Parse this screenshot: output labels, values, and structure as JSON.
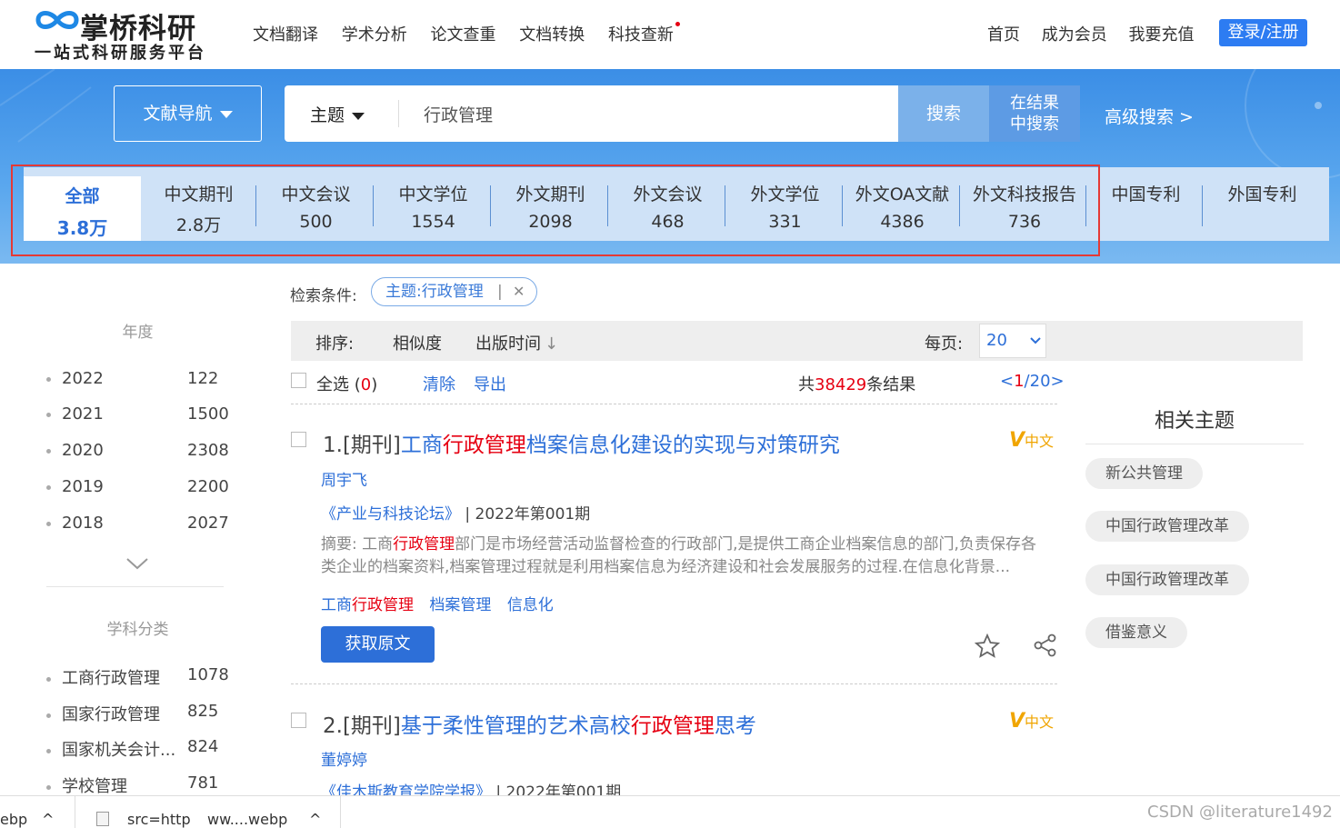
{
  "header": {
    "brand": "掌桥科研",
    "slogan": "一站式科研服务平台",
    "nav_left": [
      "文档翻译",
      "学术分析",
      "论文查重",
      "文档转换",
      "科技查新"
    ],
    "nav_right": [
      "首页",
      "成为会员",
      "我要充值"
    ],
    "login_label": "登录/注册"
  },
  "search": {
    "nav_dropdown": "文献导航",
    "field": "主题",
    "query": "行政管理",
    "search_label": "搜索",
    "result_search_line1": "在结果",
    "result_search_line2": "中搜索",
    "advanced_label": "高级搜索 >"
  },
  "tabs": [
    {
      "name": "全部",
      "count": "3.8万",
      "active": true
    },
    {
      "name": "中文期刊",
      "count": "2.8万"
    },
    {
      "name": "中文会议",
      "count": "500"
    },
    {
      "name": "中文学位",
      "count": "1554"
    },
    {
      "name": "外文期刊",
      "count": "2098"
    },
    {
      "name": "外文会议",
      "count": "468"
    },
    {
      "name": "外文学位",
      "count": "331"
    },
    {
      "name": "外文OA文献",
      "count": "4386"
    },
    {
      "name": "外文科技报告",
      "count": "736"
    },
    {
      "name": "中国专利",
      "count": ""
    },
    {
      "name": "外国专利",
      "count": ""
    }
  ],
  "sidebar": {
    "year_title": "年度",
    "years": [
      {
        "label": "2022",
        "count": "122"
      },
      {
        "label": "2021",
        "count": "1500"
      },
      {
        "label": "2020",
        "count": "2308"
      },
      {
        "label": "2019",
        "count": "2200"
      },
      {
        "label": "2018",
        "count": "2027"
      }
    ],
    "subject_title": "学科分类",
    "subjects": [
      {
        "label": "工商行政管理",
        "count": "1078"
      },
      {
        "label": "国家行政管理",
        "count": "825"
      },
      {
        "label": "国家机关会计...",
        "count": "824"
      },
      {
        "label": "学校管理",
        "count": "781"
      }
    ]
  },
  "conditions": {
    "label": "检索条件:",
    "tag": "主题:行政管理"
  },
  "sort": {
    "label": "排序:",
    "relevance": "相似度",
    "pubtime": "出版时间",
    "per_page_label": "每页:",
    "per_page_value": "20"
  },
  "select": {
    "all_label": "全选",
    "count_open": "(",
    "count": "0",
    "count_close": ")",
    "clear": "清除",
    "export": "导出",
    "total_prefix": "共",
    "total": "38429",
    "total_suffix": "条结果",
    "pager_open": "<",
    "pager_cur": "1",
    "pager_rest": "/20>"
  },
  "results": [
    {
      "prefix": "1.[期刊]",
      "title_parts": [
        "工商",
        "行政管理",
        "档案信息化建设的实现与对策研究"
      ],
      "badge_v": "V",
      "badge_lang": "中文",
      "author": "周宇飞",
      "journal": "《产业与科技论坛》",
      "issue": "| 2022年第001期",
      "abstract_parts": [
        "摘要: 工商",
        "行政管理",
        "部门是市场经营活动监督检查的行政部门,是提供工商企业档案信息的部门,负责保存各类企业的档案资料,档案管理过程就是利用档案信息为经济建设和社会发展服务的过程.在信息化背景..."
      ],
      "keywords": [
        [
          "工商",
          "行政管理"
        ],
        [
          "档案管理",
          ""
        ],
        [
          "信息化",
          ""
        ]
      ],
      "get_label": "获取原文"
    },
    {
      "prefix": "2.[期刊]",
      "title_parts": [
        "基于柔性管理的艺术高校",
        "行政管理",
        "思考"
      ],
      "badge_v": "V",
      "badge_lang": "中文",
      "author": "董婷婷",
      "journal": "《佳木斯教育学院学报》",
      "issue": "| 2022年第001期"
    }
  ],
  "related": {
    "title": "相关主题",
    "topics": [
      "新公共管理",
      "中国行政管理改革",
      "中国行政管理改革",
      "借鉴意义"
    ]
  },
  "download_bar": {
    "item1": "ebp",
    "item2a": "src=http",
    "item2b": "ww....webp"
  },
  "watermark": "CSDN @literature1492",
  "colors": {
    "accent": "#2d6fd8",
    "highlight": "#e60012",
    "banner": "#4a9be9"
  }
}
